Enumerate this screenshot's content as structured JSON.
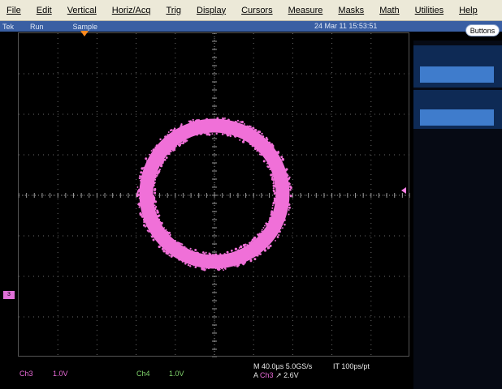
{
  "menu": [
    "File",
    "Edit",
    "Vertical",
    "Horiz/Acq",
    "Trig",
    "Display",
    "Cursors",
    "Measure",
    "Masks",
    "Math",
    "Utilities",
    "Help"
  ],
  "status": {
    "left": "Tek",
    "run": "Run",
    "mode": "Sample",
    "datetime": "24 Mar 11 15:53:51"
  },
  "buttons_label": "Buttons",
  "channels": {
    "ch3": {
      "label": "Ch3",
      "scale": "1.0V",
      "color": "#e96ad8"
    },
    "ch4": {
      "label": "Ch4",
      "scale": "1.0V",
      "color": "#7fd36b"
    }
  },
  "horizontal": {
    "time": "M 40.0µs 5.0GS/s",
    "record": "IT 100ps/pt"
  },
  "trigger": {
    "prefix": "A",
    "source": "Ch3",
    "slope": "↗",
    "level": "2.6V"
  },
  "ground_marker_label": "3",
  "display": {
    "mode": "XY",
    "trace_color": "#f070d8"
  }
}
